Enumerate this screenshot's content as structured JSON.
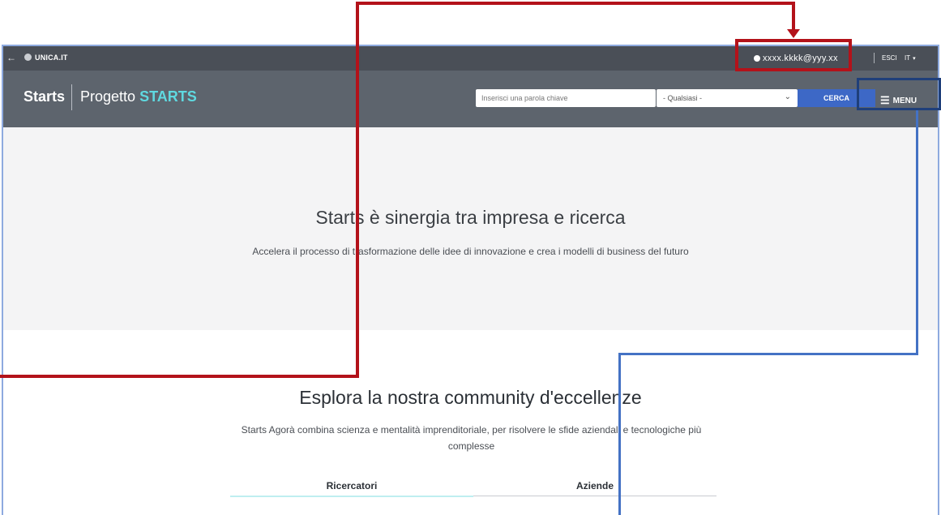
{
  "topbar": {
    "back_icon": "arrow-left-icon",
    "logo": "UNICA.IT",
    "user_email": "xxxx.kkkk@yyy.xx",
    "logout": "ESCI",
    "language": "IT"
  },
  "header": {
    "brand": "Starts",
    "project_prefix": "Progetto",
    "project_name": "STARTS",
    "search_placeholder": "Inserisci una parola chiave",
    "select_value": "- Qualsiasi -",
    "search_button": "CERCA",
    "menu_label": "MENU"
  },
  "hero": {
    "title": "Starts è sinergia tra impresa e ricerca",
    "subtitle": "Accelera il processo di trasformazione delle idee di innovazione e crea i modelli di business del futuro"
  },
  "community": {
    "title": "Esplora la nostra community d'eccellenze",
    "description": "Starts Agorà combina scienza e mentalità imprenditoriale, per risolvere le sfide aziendali e tecnologiche più complesse",
    "tabs": [
      {
        "label": "Ricercatori"
      },
      {
        "label": "Aziende"
      }
    ]
  },
  "colors": {
    "topbar": "#4a4f57",
    "header": "#5d646d",
    "accent": "#5fd9e0",
    "button": "#3d68c6",
    "annotation_red": "#b3121a",
    "annotation_blue": "#4472c4",
    "annotation_navy": "#1f3f7a"
  }
}
